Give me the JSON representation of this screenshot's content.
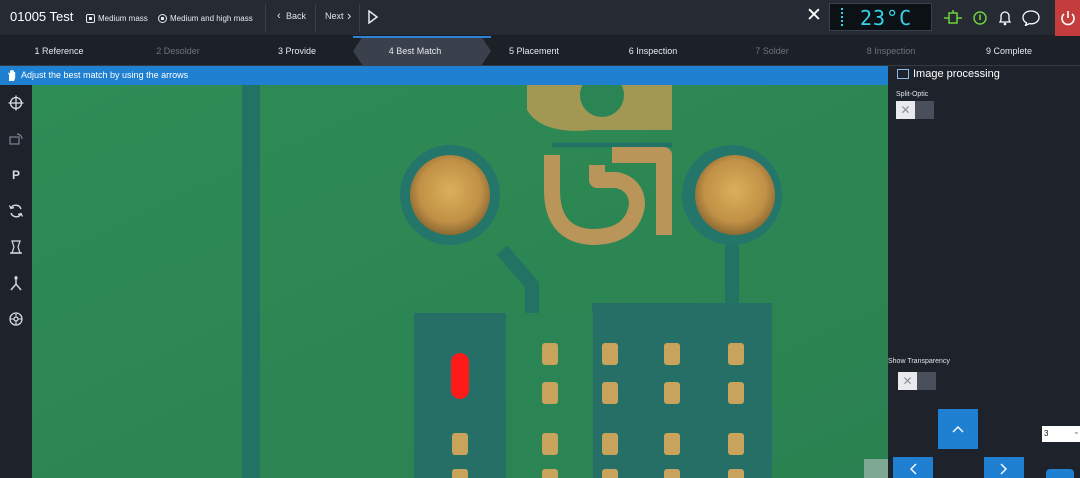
{
  "app": {
    "title": "01005 Test",
    "mass_options": [
      {
        "label": "Medium mass",
        "icon": "mass-icon"
      },
      {
        "label": "Medium and high mass",
        "icon": "mass-icon"
      }
    ],
    "nav": {
      "back_label": "Back",
      "next_label": "Next"
    },
    "temperature": "23°C",
    "colors": {
      "accent": "#1f7fd1",
      "temp": "#37d4e8",
      "status_green": "#6fd13a",
      "power": "#c43c3c"
    }
  },
  "steps": [
    {
      "label": "1 Reference",
      "state": "done"
    },
    {
      "label": "2 Desolder",
      "state": "disabled"
    },
    {
      "label": "3 Provide",
      "state": "done"
    },
    {
      "label": "4 Best Match",
      "state": "active"
    },
    {
      "label": "5 Placement",
      "state": "todo"
    },
    {
      "label": "6 Inspection",
      "state": "todo"
    },
    {
      "label": "7 Solder",
      "state": "disabled"
    },
    {
      "label": "8 Inspection",
      "state": "disabled"
    },
    {
      "label": "9 Complete",
      "state": "todo"
    }
  ],
  "instruction": "Adjust the best match by using the arrows",
  "tools": [
    "move-icon",
    "rotate-camera-icon",
    "p-icon",
    "refresh-icon",
    "nozzle-icon",
    "probe-icon",
    "settings-wheel-icon"
  ],
  "tool_p_label": "P",
  "panel": {
    "title": "Image processing",
    "split_optic_label": "Split-Optic",
    "show_transparency_label": "Show Transparency",
    "step_value": "3",
    "step_unit": "≈"
  }
}
